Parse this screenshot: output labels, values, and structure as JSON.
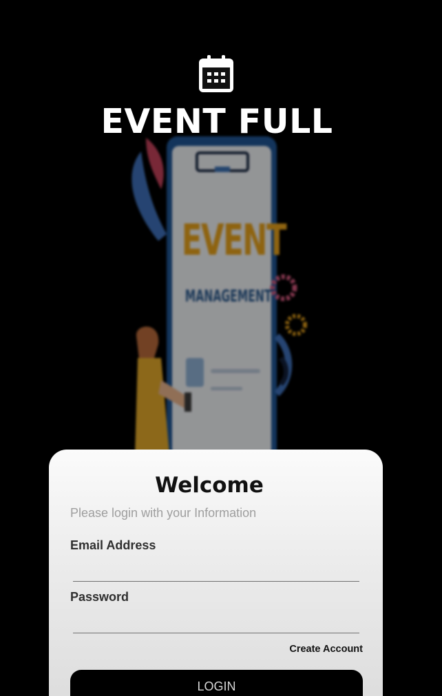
{
  "app": {
    "title": "EVENT FULL",
    "icon": "calendar-icon"
  },
  "hero": {
    "headline": "EVENT",
    "subline": "MANAGEMENT"
  },
  "login_card": {
    "title": "Welcome",
    "subtitle": "Please login with your Information",
    "email_label": "Email Address",
    "email_value": "",
    "password_label": "Password",
    "password_value": "",
    "create_account_label": "Create Account",
    "login_label": "LOGIN"
  },
  "colors": {
    "background": "#000000",
    "card": "#f5f5f5",
    "button": "#000000",
    "hero_accent": "#e6a11b",
    "hero_secondary": "#2b5a8e"
  }
}
